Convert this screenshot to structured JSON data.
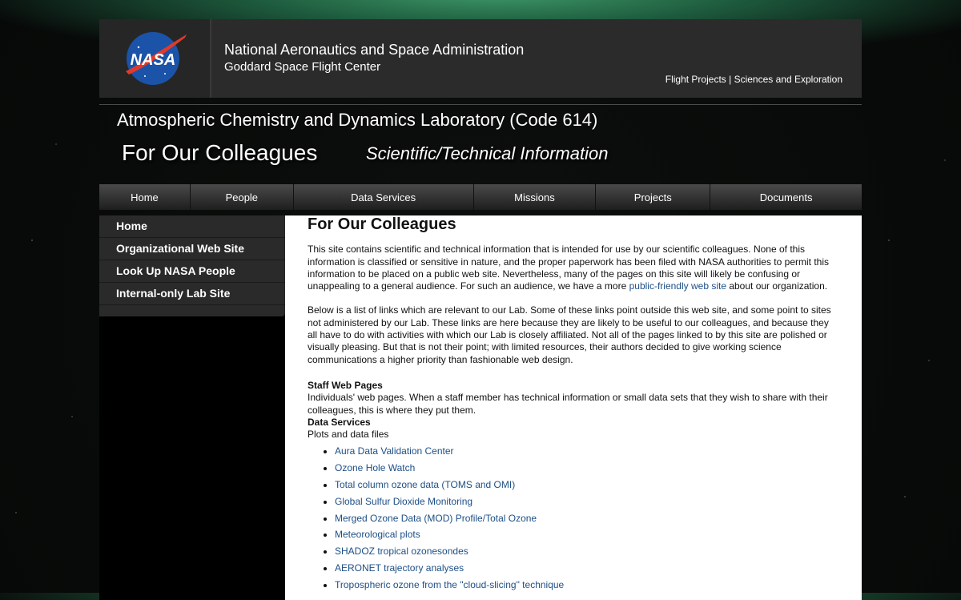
{
  "header": {
    "logo_text": "NASA",
    "org_name": "National Aeronautics and Space Administration",
    "center_name": "Goddard Space Flight Center",
    "links": [
      "Flight Projects",
      "Sciences and Exploration"
    ],
    "link_separator": " | "
  },
  "lab_title": "Atmospheric Chemistry and Dynamics Laboratory (Code 614)",
  "page_title": "For Our Colleagues",
  "page_subtitle": "Scientific/Technical Information",
  "nav": [
    "Home",
    "People",
    "Data Services",
    "Missions",
    "Projects",
    "Documents"
  ],
  "sidebar": [
    "Home",
    "Organizational Web Site",
    "Look Up NASA People",
    "Internal-only Lab Site"
  ],
  "content": {
    "heading": "For Our Colleagues",
    "p1_before": "This site contains scientific and technical information that is intended for use by our scientific colleagues. None of this information is classified or sensitive in nature, and the proper paperwork has been filed with NASA authorities to permit this information to be placed on a public web site. Nevertheless, many of the pages on this site will likely be confusing or unappealing to a general audience. For such an audience, we have a more ",
    "p1_link": "public-friendly web site",
    "p1_after": " about our organization.",
    "p2": "Below is a list of links which are relevant to our Lab. Some of these links point outside this web site, and some point to sites not administered by our Lab. These links are here because they are likely to be useful to our colleagues, and because they all have to do with activities with which our Lab is closely affiliated. Not all of the pages linked to by this site are polished or visually pleasing. But that is not their point; with limited resources, their authors decided to give working science communications a higher priority than fashionable web design.",
    "staff_heading": "Staff Web Pages",
    "staff_text": "Individuals' web pages. When a staff member has technical information or small data sets that they wish to share with their colleagues, this is where they put them.",
    "data_heading": "Data Services",
    "data_text": "Plots and data files",
    "data_links": [
      "Aura Data Validation Center",
      "Ozone Hole Watch",
      "Total column ozone data (TOMS and OMI)",
      "Global Sulfur Dioxide Monitoring",
      "Merged Ozone Data (MOD) Profile/Total Ozone",
      "Meteorological plots",
      "SHADOZ tropical ozonesondes",
      "AERONET trajectory analyses",
      "Tropospheric ozone from the \"cloud-slicing\" technique"
    ]
  },
  "colors": {
    "header_bg": "#2b2b2b",
    "link": "#1d4f86",
    "nasa_blue": "#1a53a8",
    "nasa_red": "#e03a2b"
  }
}
